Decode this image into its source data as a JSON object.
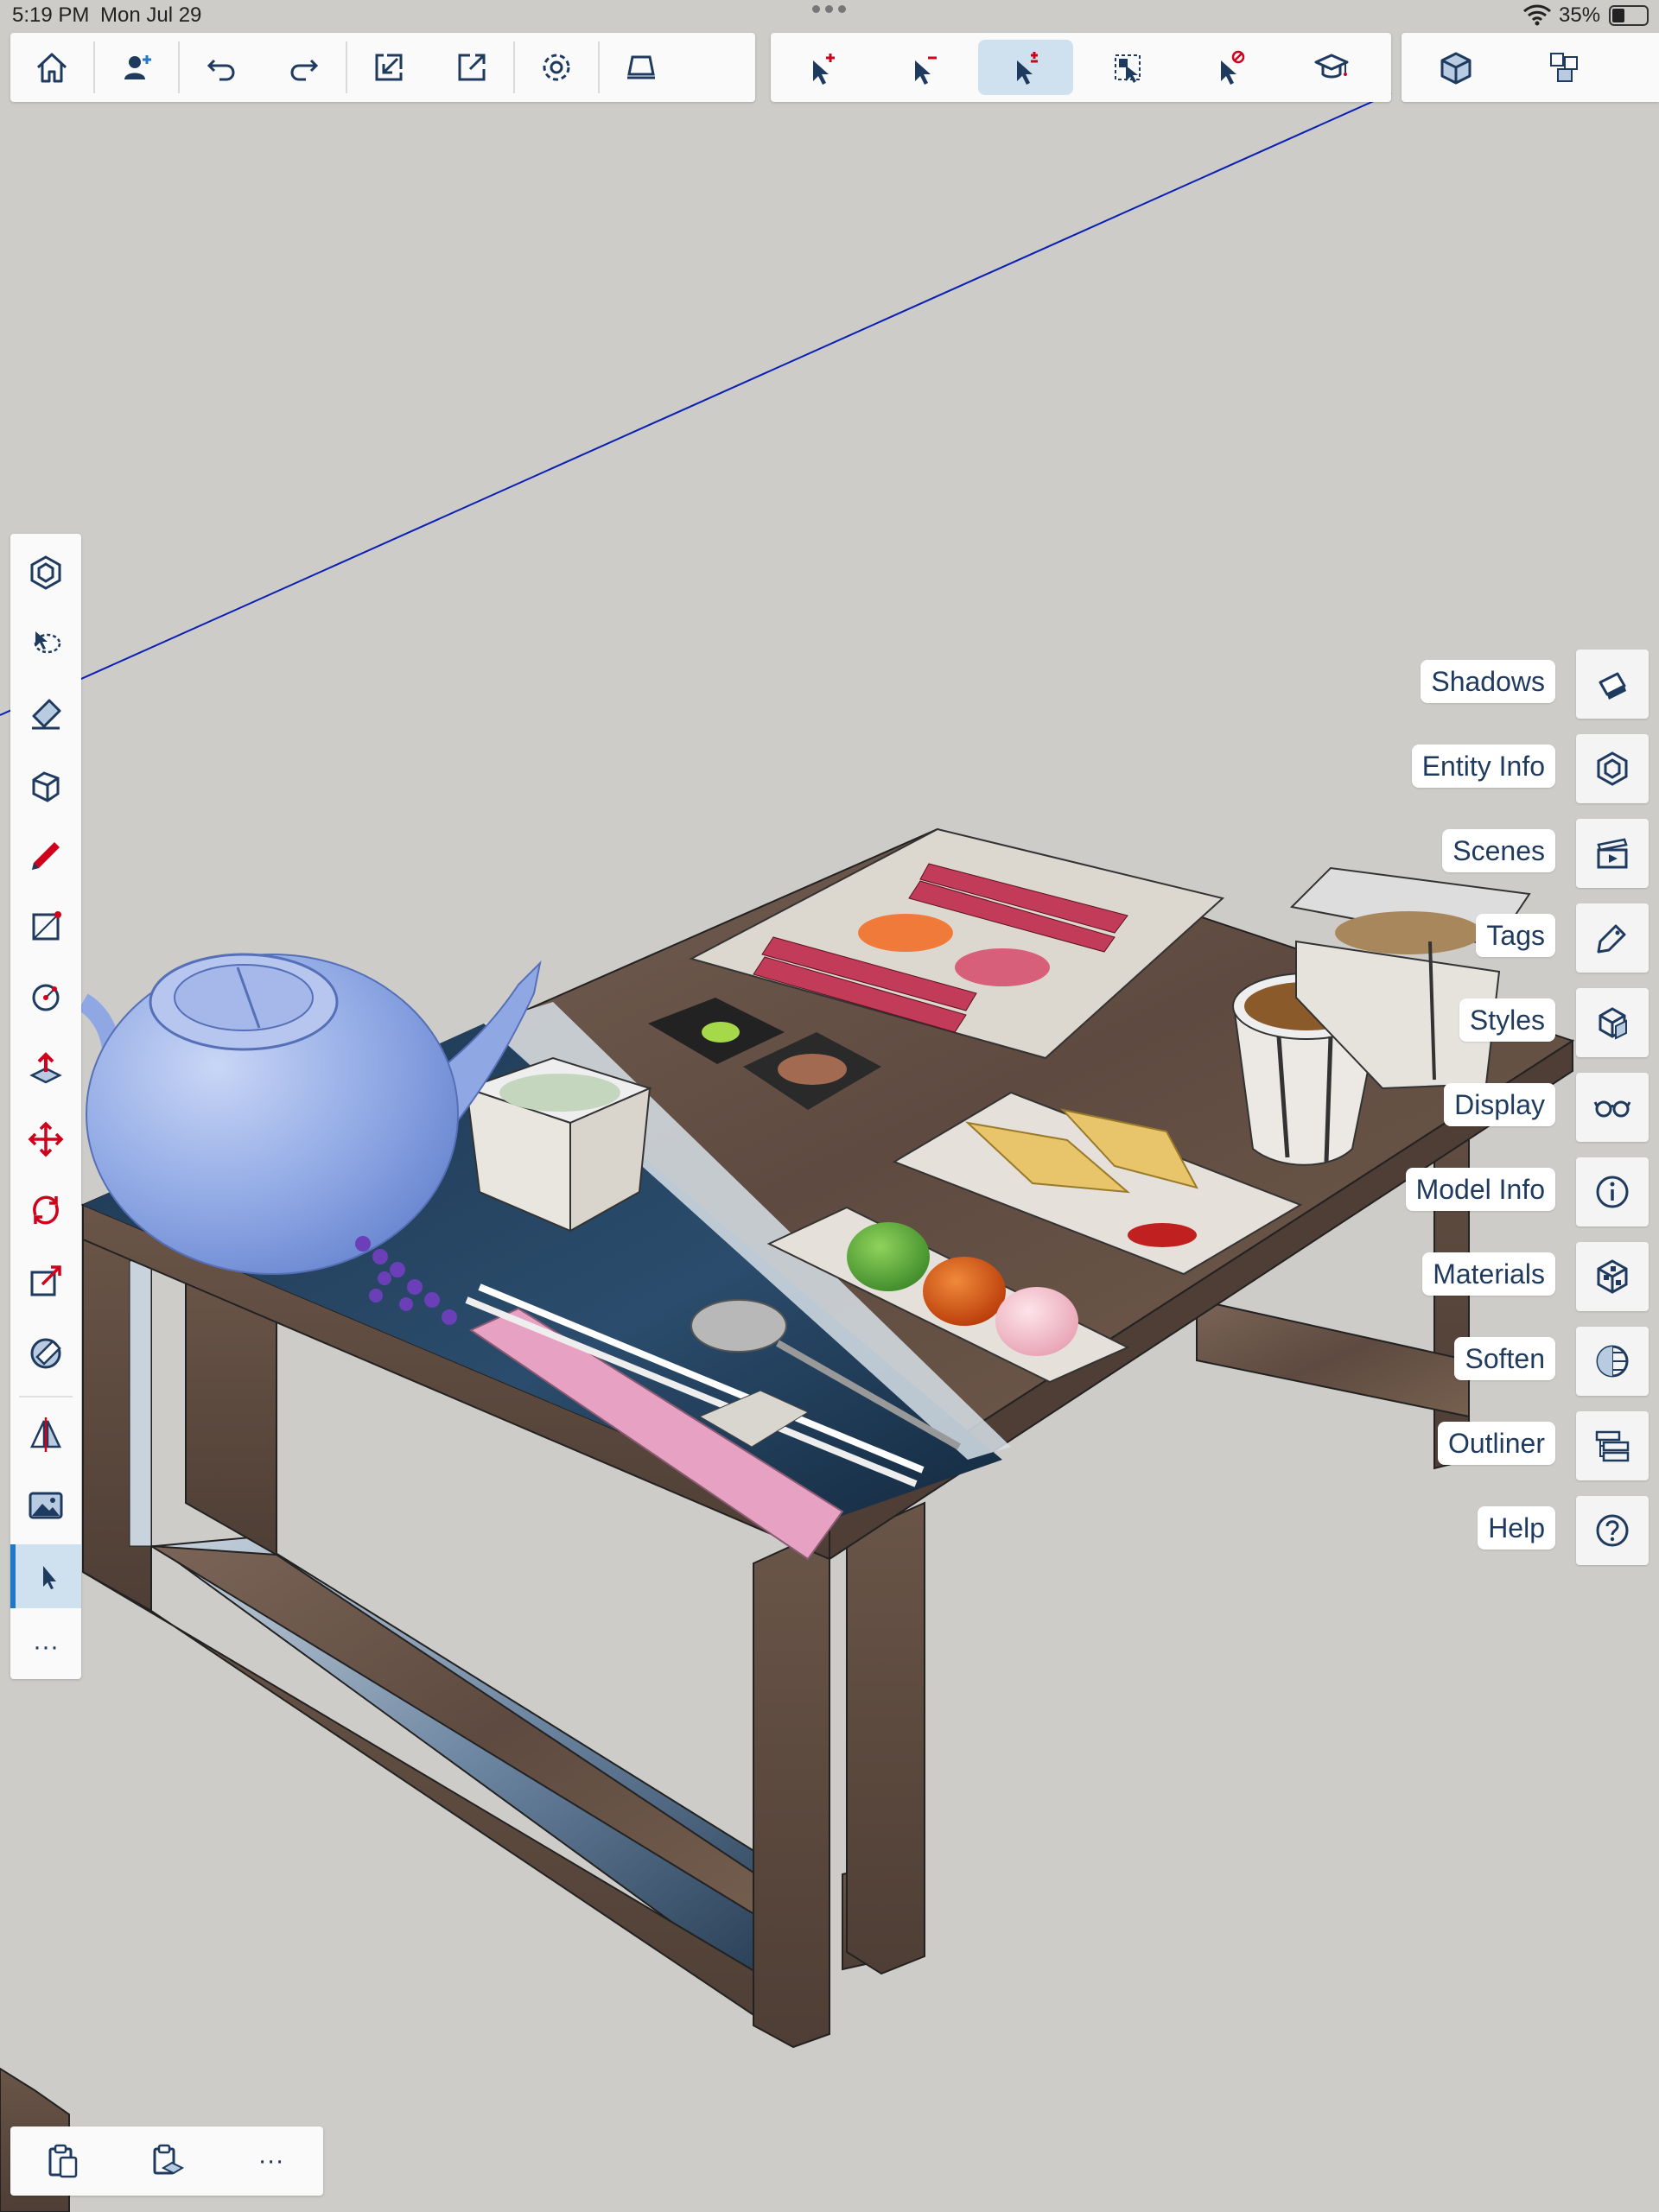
{
  "status_bar": {
    "time": "5:19 PM",
    "date": "Mon Jul 29",
    "battery": "35%"
  },
  "top_toolbar": {
    "main_tools": [
      "home-icon",
      "collaborator-icon",
      "undo-icon",
      "redo-icon",
      "import-icon",
      "export-icon",
      "settings-icon",
      "display-section-icon"
    ],
    "selection_tools": [
      "select-add-icon",
      "select-remove-icon",
      "select-toggle-icon",
      "select-group-icon",
      "select-clear-icon",
      "learn-icon"
    ],
    "selection_active_index": 2,
    "view_tools": [
      "view-iso-icon",
      "view-components-icon",
      "view-section-icon"
    ]
  },
  "left_toolbar": {
    "tools": [
      "component-icon",
      "lasso-icon",
      "eraser-icon",
      "tape-icon",
      "pencil-icon",
      "rectangle-icon",
      "circle-icon",
      "push-pull-icon",
      "move-icon",
      "rotate-icon",
      "scale-icon",
      "paint-bucket-icon",
      "section-plane-icon",
      "image-icon",
      "select-icon"
    ],
    "active_tool": "select-icon",
    "more_label": "···"
  },
  "panels": [
    {
      "label": "Shadows",
      "icon": "shadows-icon"
    },
    {
      "label": "Entity Info",
      "icon": "entity-info-icon"
    },
    {
      "label": "Scenes",
      "icon": "scenes-icon"
    },
    {
      "label": "Tags",
      "icon": "tags-icon"
    },
    {
      "label": "Styles",
      "icon": "styles-icon"
    },
    {
      "label": "Display",
      "icon": "display-icon"
    },
    {
      "label": "Model Info",
      "icon": "model-info-icon"
    },
    {
      "label": "Materials",
      "icon": "materials-icon"
    },
    {
      "label": "Soften",
      "icon": "soften-icon"
    },
    {
      "label": "Outliner",
      "icon": "outliner-icon"
    },
    {
      "label": "Help",
      "icon": "help-icon"
    }
  ],
  "bottom_toolbar": {
    "tools": [
      "clipboard-icon",
      "paste-in-place-icon"
    ],
    "more_label": "···"
  },
  "colors": {
    "canvas": "#cdccc8",
    "accent": "#1f78c8",
    "icon": "#1e3a5f",
    "axis_blue": "#0a1fb4",
    "active_bg": "#cfe0ee"
  }
}
